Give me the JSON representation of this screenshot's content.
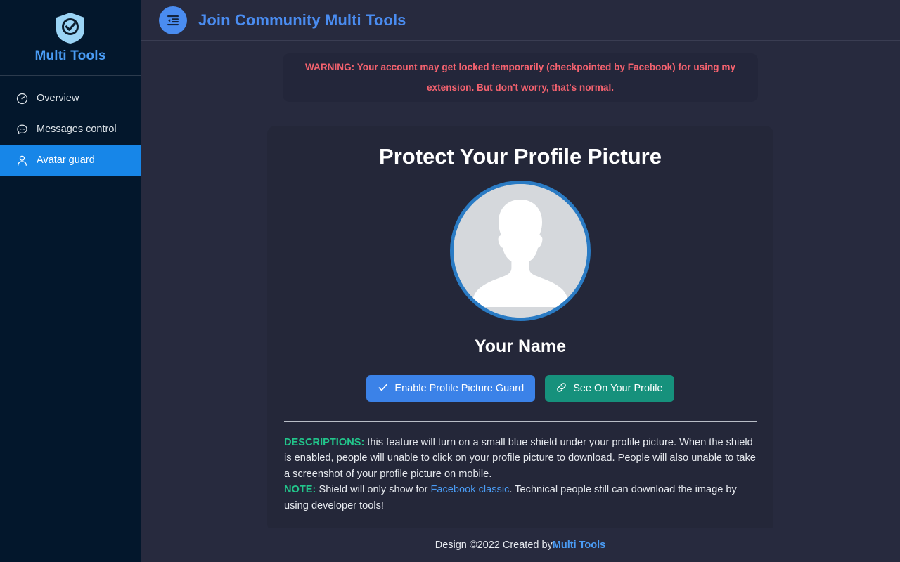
{
  "sidebar": {
    "brand": {
      "name": "Multi Tools",
      "logo_icon": "shield-check-icon"
    },
    "items": [
      {
        "label": "Overview",
        "icon": "gauge-icon",
        "active": false
      },
      {
        "label": "Messages control",
        "icon": "chat-bubble-icon",
        "active": false
      },
      {
        "label": "Avatar guard",
        "icon": "person-icon",
        "active": true
      }
    ]
  },
  "topbar": {
    "icon": "list-indent-icon",
    "title": "Join Community Multi Tools"
  },
  "warning": {
    "text": "WARNING: Your account may get locked temporarily (checkpointed by Facebook) for using my extension. But don't worry, that's normal.",
    "color": "#f4626f"
  },
  "card": {
    "title": "Protect Your Profile Picture",
    "avatar_icon": "default-user-avatar",
    "profile_name": "Your Name",
    "buttons": [
      {
        "label": "Enable Profile Picture Guard",
        "icon": "check-icon",
        "color": "#3b82e8"
      },
      {
        "label": "See On Your Profile",
        "icon": "link-icon",
        "color": "#16917c"
      }
    ],
    "descriptions": {
      "desc_label": "DESCRIPTIONS:",
      "desc_body": " this feature will turn on a small blue shield under your profile picture. When the shield is enabled, people will unable to click on your profile picture to download. People will also unable to take a screenshot of your profile picture on mobile.",
      "note_label": "NOTE:",
      "note_before": " Shield will only show for ",
      "note_link": "Facebook classic",
      "note_after": ". Technical people still can download the image by using developer tools!"
    }
  },
  "footer": {
    "prefix": "Design ©2022 Created by ",
    "brand": "Multi Tools"
  }
}
